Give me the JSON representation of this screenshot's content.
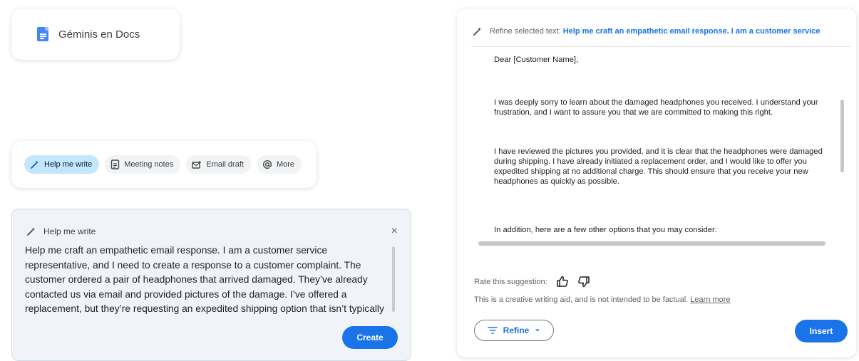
{
  "title_card": {
    "label": "Géminis en Docs"
  },
  "chips": [
    {
      "label": "Help me write",
      "icon": "pen-sparkle-icon"
    },
    {
      "label": "Meeting notes",
      "icon": "document-icon"
    },
    {
      "label": "Email draft",
      "icon": "email-draft-icon"
    },
    {
      "label": "More",
      "icon": "at-sign-icon"
    }
  ],
  "write_panel": {
    "title": "Help me write",
    "close_label": "×",
    "prompt_text": "Help me craft an empathetic email response. I am a customer service representative, and  I need to create a response to a customer complaint. The customer ordered a pair of headphones that arrived damaged. They’ve already contacted us via email and provided pictures of the damage. I’ve offered a replacement, but they’re requesting an expedited shipping option that isn’t typically",
    "create_label": "Create"
  },
  "refine_panel": {
    "heading_prefix": "Refine selected text:",
    "heading_query": "Help me craft an empathetic email response. I am a customer service",
    "greeting": "Dear [Customer Name],",
    "paragraphs": [
      "I was deeply sorry to learn about the damaged headphones you received. I understand your frustration, and I want to assure you that we are committed to making this right.",
      "I have reviewed the pictures you provided, and it is clear that the headphones were damaged during shipping. I have already initiated a replacement order, and I would like to offer you expedited shipping at no additional charge. This should ensure that you receive your new headphones as quickly as possible.",
      "In addition, here are a few other options that you may consider:"
    ],
    "rate_label": "Rate this suggestion:",
    "disclaimer": "This is a creative writing aid, and is not intended to be factual.",
    "learn_more": "Learn more",
    "refine_label": "Refine",
    "insert_label": "Insert"
  },
  "colors": {
    "accent": "#1a73e8",
    "chip_active": "#c2e7ff",
    "panel_bg": "#f0f4f9"
  }
}
